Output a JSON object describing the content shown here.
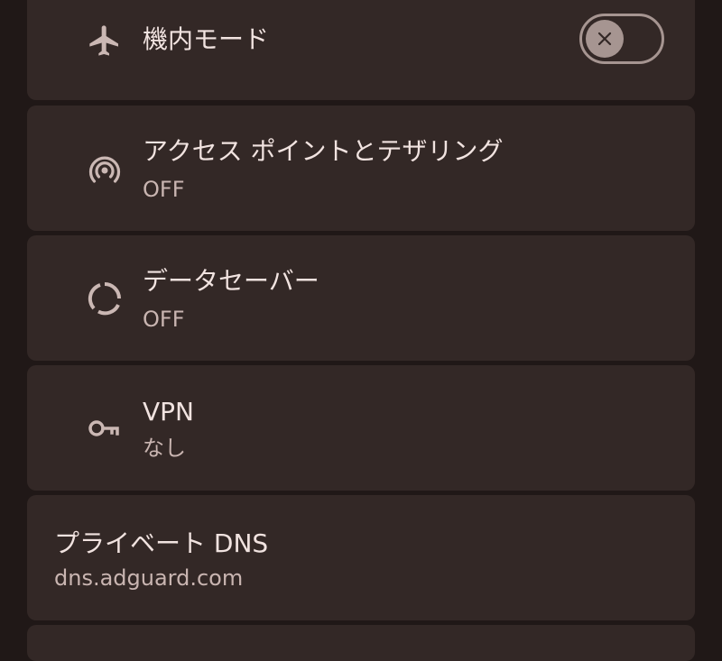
{
  "settings": {
    "airplane_mode": {
      "title": "機内モード",
      "icon": "airplane-icon",
      "toggle_on": false,
      "toggle_icon": "close-icon"
    },
    "hotspot": {
      "title": "アクセス ポイントとテザリング",
      "subtitle": "OFF",
      "icon": "hotspot-icon"
    },
    "data_saver": {
      "title": "データセーバー",
      "subtitle": "OFF",
      "icon": "data-saver-icon"
    },
    "vpn": {
      "title": "VPN",
      "subtitle": "なし",
      "icon": "key-icon"
    },
    "private_dns": {
      "title": "プライベート DNS",
      "subtitle": "dns.adguard.com"
    }
  },
  "colors": {
    "background": "#201817",
    "card": "#332826",
    "title_text": "#f1e3e0",
    "subtitle_text": "#c9b5b1",
    "icon": "#cbb8b4",
    "toggle": "#a69591"
  }
}
